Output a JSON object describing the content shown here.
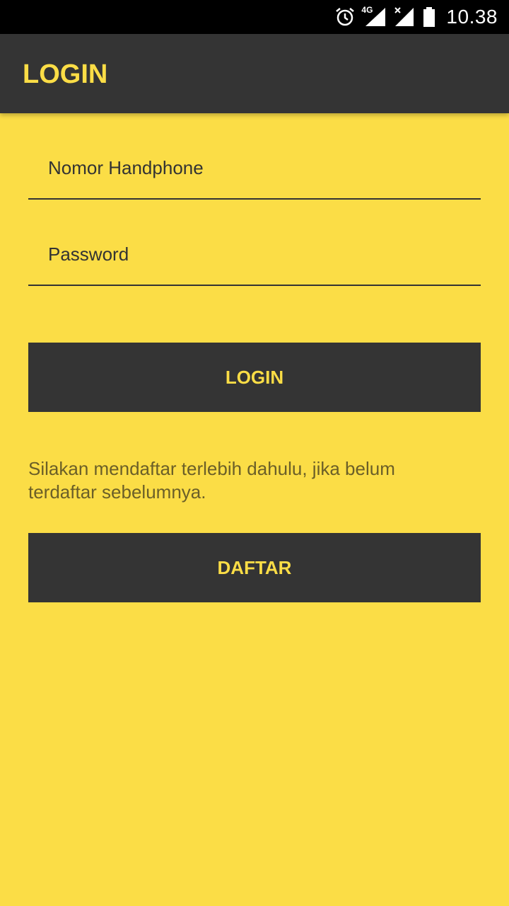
{
  "status_bar": {
    "time": "10.38",
    "network_label": "4G",
    "icons": [
      "alarm-icon",
      "signal-4g-icon",
      "signal-no-service-icon",
      "battery-icon"
    ]
  },
  "app_bar": {
    "title": "LOGIN"
  },
  "form": {
    "phone_placeholder": "Nomor Handphone",
    "phone_value": "",
    "password_placeholder": "Password",
    "password_value": "",
    "login_label": "LOGIN"
  },
  "register": {
    "hint": "Silakan mendaftar terlebih dahulu, jika belum terdaftar sebelumnya.",
    "button_label": "DAFTAR"
  },
  "colors": {
    "background": "#fbdd46",
    "primary_dark": "#343434",
    "accent": "#fbdd46"
  }
}
